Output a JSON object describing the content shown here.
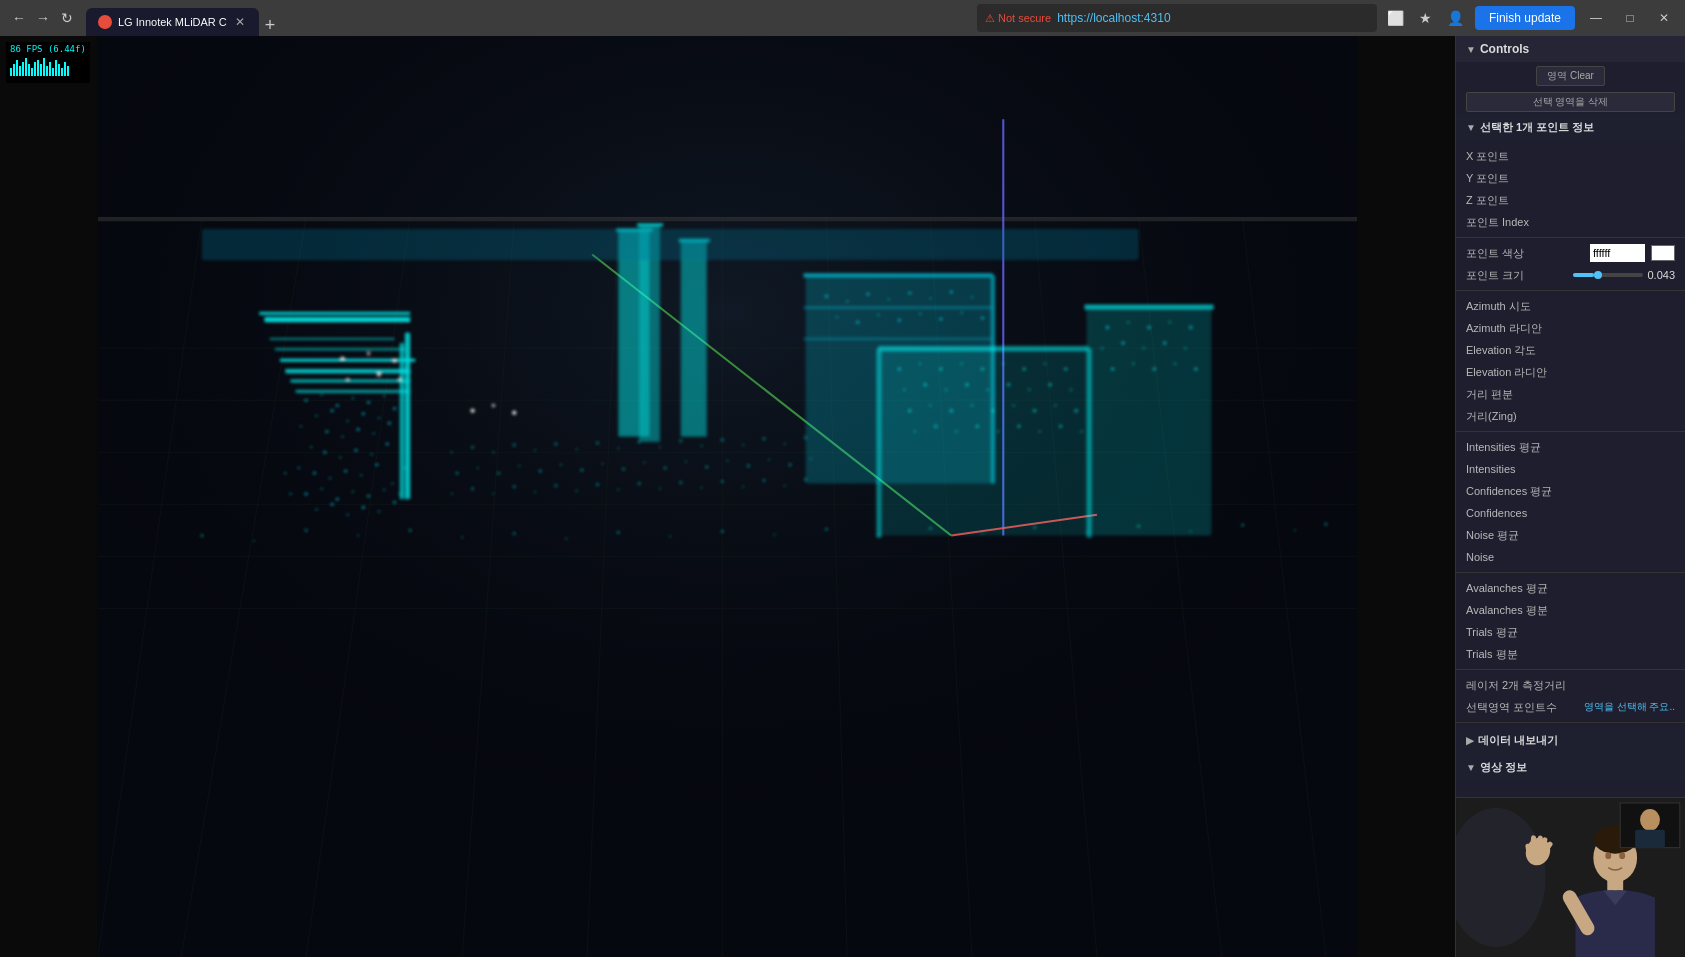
{
  "browser": {
    "tab_title": "LG Innotek MLiDAR C",
    "tab_favicon_color": "#e74c3c",
    "url": "https://localhost:4310",
    "security_warning": "Not secure",
    "finish_update_label": "Finish update",
    "window_controls": [
      "—",
      "□",
      "✕"
    ]
  },
  "viewport": {
    "fps_label": "86 FPS (6.44f)"
  },
  "controls_panel": {
    "title": "Controls",
    "clear_button": "영역 Clear",
    "delete_selection_button": "선택 영역을 삭제",
    "point_info_section": "선택한 1개 포인트 정보",
    "rows": [
      {
        "label": "X 포인트",
        "value": ""
      },
      {
        "label": "Y 포인트",
        "value": ""
      },
      {
        "label": "Z 포인트",
        "value": ""
      },
      {
        "label": "포인트 Index",
        "value": ""
      },
      {
        "label": "포인트 색상",
        "value": "ffffff",
        "has_input": true,
        "input_val": ""
      },
      {
        "label": "포인트 크기",
        "value": "0.043",
        "has_slider": true,
        "slider_pct": 30
      },
      {
        "label": "Azimuth 시도",
        "value": ""
      },
      {
        "label": "Azimuth 라디안",
        "value": ""
      },
      {
        "label": "Elevation 각도",
        "value": ""
      },
      {
        "label": "Elevation 라디안",
        "value": ""
      },
      {
        "label": "거리 편분",
        "value": ""
      },
      {
        "label": "거리(Zing)",
        "value": ""
      },
      {
        "label": "Intensities 평균",
        "value": ""
      },
      {
        "label": "Intensities",
        "value": ""
      },
      {
        "label": "Confidences 평균",
        "value": ""
      },
      {
        "label": "Confidences",
        "value": ""
      },
      {
        "label": "Noise 평균",
        "value": ""
      },
      {
        "label": "Noise",
        "value": ""
      },
      {
        "label": "Avalanches 평균",
        "value": ""
      },
      {
        "label": "Avalanches 평분",
        "value": ""
      },
      {
        "label": "Trials 평균",
        "value": ""
      },
      {
        "label": "Trials 평분",
        "value": ""
      },
      {
        "label": "레이저 2개 측정거리",
        "value": ""
      },
      {
        "label": "선택영역 포인트수",
        "value": "",
        "highlighted": "영역을 선택해 주요.."
      }
    ],
    "export_section": "데이터 내보내기",
    "video_section": "영상 정보"
  }
}
